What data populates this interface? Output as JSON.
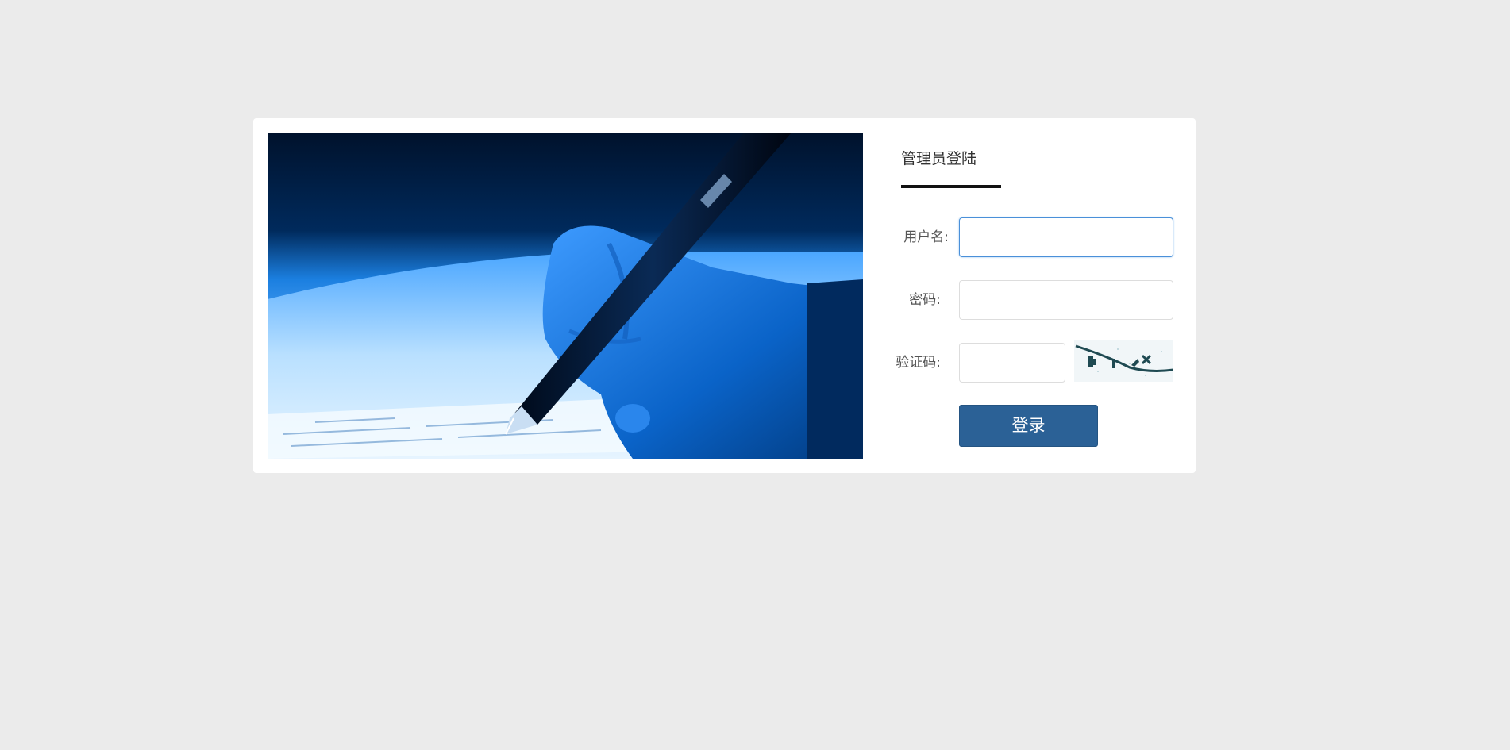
{
  "login": {
    "tab_label": "管理员登陆",
    "username": {
      "label": "用户名:",
      "value": ""
    },
    "password": {
      "label": "密码:",
      "value": ""
    },
    "captcha": {
      "label": "验证码:",
      "value": ""
    },
    "submit_label": "登录"
  },
  "theme": {
    "background": "#ebebeb",
    "card": "#ffffff",
    "button": "#2b6196",
    "focus_border": "#4a90d9"
  },
  "images": {
    "hero": "hand-writing-with-fountain-pen-photo",
    "captcha": "captcha-image"
  }
}
